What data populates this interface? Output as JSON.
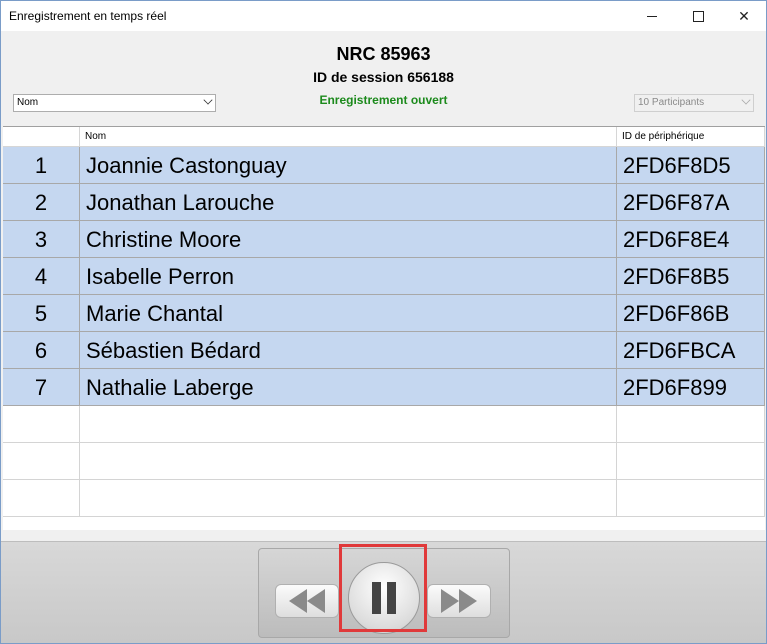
{
  "window": {
    "title": "Enregistrement en temps réel"
  },
  "header": {
    "nrc": "NRC 85963",
    "session": "ID de session 656188",
    "status": "Enregistrement ouvert",
    "status_color": "#1c8a1c",
    "sort_select": "Nom",
    "participants_select": "10 Participants"
  },
  "grid": {
    "columns": [
      "",
      "Nom",
      "ID de périphérique"
    ],
    "rows": [
      {
        "num": "1",
        "name": "Joannie Castonguay",
        "device": "2FD6F8D5"
      },
      {
        "num": "2",
        "name": "Jonathan Larouche",
        "device": "2FD6F87A"
      },
      {
        "num": "3",
        "name": "Christine Moore",
        "device": "2FD6F8E4"
      },
      {
        "num": "4",
        "name": "Isabelle Perron",
        "device": "2FD6F8B5"
      },
      {
        "num": "5",
        "name": "Marie Chantal",
        "device": "2FD6F86B"
      },
      {
        "num": "6",
        "name": "Sébastien Bédard",
        "device": "2FD6FBCA"
      },
      {
        "num": "7",
        "name": "Nathalie Laberge",
        "device": "2FD6F899"
      }
    ],
    "row_color": "#c5d7f0"
  },
  "transport": {
    "highlight_color": "#e0393a"
  }
}
